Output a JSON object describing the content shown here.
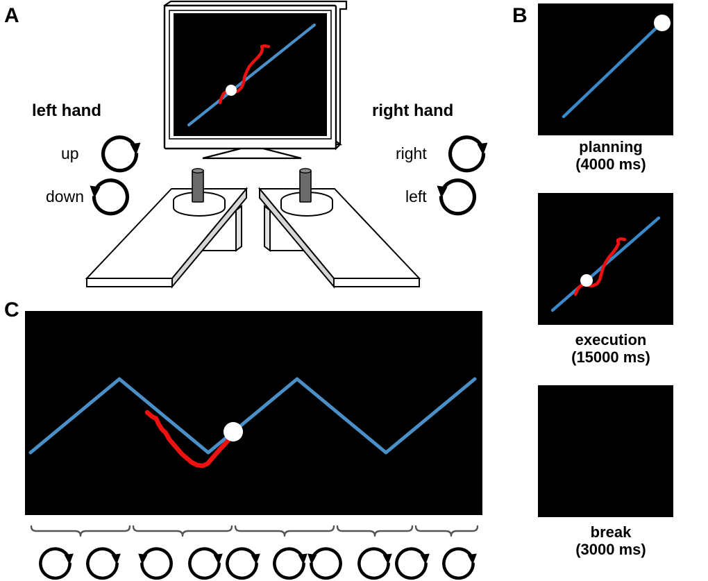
{
  "figure": {
    "panels": [
      {
        "id": "A",
        "letter": "A"
      },
      {
        "id": "B",
        "letter": "B"
      },
      {
        "id": "C",
        "letter": "C"
      }
    ]
  },
  "panel_a": {
    "letter": "A",
    "left_hand": {
      "title": "left hand",
      "directions": [
        {
          "label": "up",
          "rotation": "clockwise"
        },
        {
          "label": "down",
          "rotation": "counter-clockwise"
        }
      ]
    },
    "right_hand": {
      "title": "right hand",
      "directions": [
        {
          "label": "right",
          "rotation": "clockwise"
        },
        {
          "label": "left",
          "rotation": "counter-clockwise"
        }
      ]
    },
    "monitor": {
      "screen_background": "#000000",
      "target_line_color": "#4a8fc7",
      "trace_color": "#ee1111",
      "cursor_color": "#ffffff"
    },
    "apparatus": {
      "boards": 2,
      "knob_color": "#ffffff",
      "handle_color": "#6b6b6b"
    }
  },
  "panel_b": {
    "letter": "B",
    "frames": [
      {
        "name": "planning",
        "caption": "planning",
        "duration": "(4000 ms)",
        "content": "line-and-cursor"
      },
      {
        "name": "execution",
        "caption": "execution",
        "duration": "(15000 ms)",
        "content": "line-cursor-and-trace"
      },
      {
        "name": "break",
        "caption": "break",
        "duration": "(3000 ms)",
        "content": "blank"
      }
    ],
    "screen_background": "#000000",
    "target_line_color": "#4a8fc7",
    "trace_color": "#ee1111",
    "cursor_color": "#ffffff"
  },
  "panel_c": {
    "letter": "C",
    "screen_background": "#000000",
    "target_line_color": "#4a8fc7",
    "trace_color": "#ee1111",
    "cursor_color": "#ffffff",
    "segment_groups": [
      {
        "index": 1,
        "rotations": [
          "clockwise",
          "clockwise"
        ]
      },
      {
        "index": 2,
        "rotations": [
          "counter-clockwise",
          "clockwise"
        ]
      },
      {
        "index": 3,
        "rotations": [
          "clockwise",
          "clockwise"
        ]
      },
      {
        "index": 4,
        "rotations": [
          "counter-clockwise",
          "clockwise"
        ]
      },
      {
        "index": 5,
        "rotations": [
          "clockwise",
          "clockwise"
        ]
      }
    ]
  },
  "chart_data": {
    "type": "line",
    "title": "",
    "xlabel": "",
    "ylabel": "",
    "grid": false,
    "legend": "none",
    "series": [
      {
        "name": "target path",
        "color": "#4a8fc7",
        "points": [
          {
            "x": 0,
            "y": 32
          },
          {
            "x": 20,
            "y": 76
          },
          {
            "x": 40,
            "y": 24
          },
          {
            "x": 60,
            "y": 76
          },
          {
            "x": 80,
            "y": 24
          },
          {
            "x": 100,
            "y": 76
          }
        ]
      },
      {
        "name": "participant trace",
        "color": "#ee1111",
        "points": [
          {
            "x": 30.5,
            "y": 50
          },
          {
            "x": 32.5,
            "y": 45
          },
          {
            "x": 34.0,
            "y": 41
          },
          {
            "x": 35.5,
            "y": 35
          },
          {
            "x": 37.0,
            "y": 29
          },
          {
            "x": 38.5,
            "y": 22
          },
          {
            "x": 40.0,
            "y": 17
          },
          {
            "x": 41.5,
            "y": 16
          },
          {
            "x": 43.0,
            "y": 21
          },
          {
            "x": 44.5,
            "y": 29
          },
          {
            "x": 46.0,
            "y": 37
          }
        ]
      }
    ],
    "cursor": {
      "x": 47,
      "y": 42,
      "color": "#ffffff"
    }
  }
}
